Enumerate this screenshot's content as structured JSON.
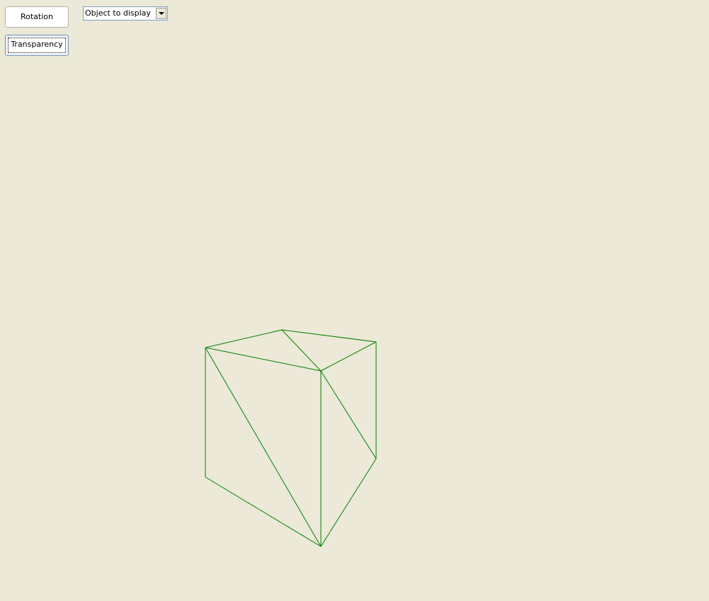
{
  "controls": {
    "rotation_label": "Rotation",
    "transparency_label": "Transparency",
    "object_select_value": "Object to display"
  },
  "scene": {
    "wireframe_color": "#008000",
    "background_color": "#ece9d8"
  }
}
